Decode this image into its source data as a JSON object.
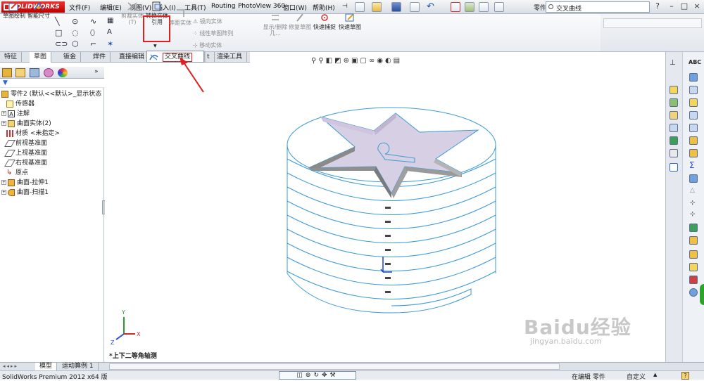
{
  "app": {
    "name": "SOLIDWORKS",
    "doc_title": "零件2 *"
  },
  "menu": [
    "文件(F)",
    "编辑(E)",
    "视图(V)",
    "插入(I)",
    "工具(T)",
    "Routing",
    "PhotoView 360",
    "窗口(W)",
    "帮助(H)"
  ],
  "search": {
    "value": "交叉曲线"
  },
  "window_controls": [
    "?",
    "–",
    "□",
    "×"
  ],
  "toolbar": {
    "sketch": "草图绘制",
    "smart_dim": "智能尺寸",
    "trim": "剪裁实体(T)",
    "convert": "转换实体引用",
    "offset": "等距实体",
    "mirror": "镜向实体",
    "linear_pattern": "线性草图阵列",
    "move": "移动实体",
    "show_relations": "显示/删除几...",
    "repair": "修复草图",
    "quick_snaps": "快速捕捉",
    "rapid_sketch": "快速草图"
  },
  "tabs": [
    "特征",
    "草图",
    "钣金",
    "焊件",
    "直接编辑",
    "t",
    "渲染工具"
  ],
  "active_tab": "草图",
  "flyout": {
    "label": "交叉曲线"
  },
  "feature_tree": {
    "root": "零件2 (默认<<默认>_显示状态",
    "items": [
      "传感器",
      "注解",
      "曲面实体(2)",
      "材质 <未指定>",
      "前视基准面",
      "上视基准面",
      "右视基准面",
      "原点",
      "曲面-拉伸1",
      "曲面-扫描1"
    ]
  },
  "viewport": {
    "view_label": "*上下二等角轴测"
  },
  "model_tabs": [
    "模型",
    "运动算例 1"
  ],
  "status": {
    "left": "SolidWorks Premium 2012 x64 版",
    "editing": "在编辑 零件",
    "custom": "自定义"
  },
  "watermark": {
    "main": "Baidu经验",
    "sub": "jingyan.baidu.com"
  },
  "colors": {
    "accent_red": "#e02020",
    "model_line": "#3a9ad6",
    "star_side": "#c6b9d6"
  }
}
